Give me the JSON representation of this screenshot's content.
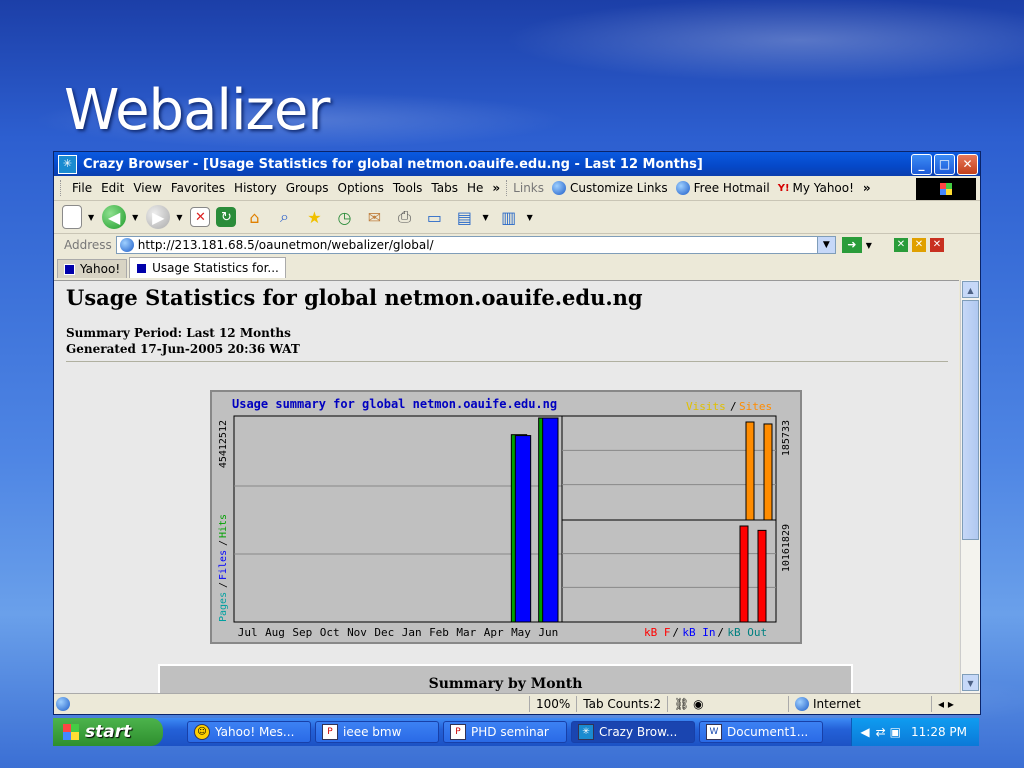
{
  "slide": {
    "title": "Webalizer"
  },
  "window": {
    "title": "Crazy Browser - [Usage Statistics for global netmon.oauife.edu.ng - Last 12 Months]",
    "controls": {
      "minimize": "_",
      "maximize": "□",
      "close": "✕"
    }
  },
  "menu": {
    "items": [
      "File",
      "Edit",
      "View",
      "Favorites",
      "History",
      "Groups",
      "Options",
      "Tools",
      "Tabs",
      "He"
    ],
    "more": "»",
    "links_label": "Links",
    "links": [
      "Customize Links",
      "Free Hotmail",
      "My Yahoo!"
    ],
    "links_more": "»"
  },
  "address": {
    "label": "Address",
    "url": "http://213.181.68.5/oaunetmon/webalizer/global/"
  },
  "tabs": [
    {
      "label": "Yahoo!",
      "active": false
    },
    {
      "label": "Usage Statistics for...",
      "active": true
    }
  ],
  "page": {
    "heading": "Usage Statistics for global netmon.oauife.edu.ng",
    "summary_period": "Summary Period: Last 12 Months",
    "generated": "Generated 17-Jun-2005 20:36 WAT",
    "month_summary_title": "Summary by Month"
  },
  "chart_data": {
    "type": "bar",
    "title": "Usage summary for global netmon.oauife.edu.ng",
    "categories": [
      "Jul",
      "Aug",
      "Sep",
      "Oct",
      "Nov",
      "Dec",
      "Jan",
      "Feb",
      "Mar",
      "Apr",
      "May",
      "Jun"
    ],
    "left_panel": {
      "ymax_label": "45412512",
      "ymax": 45412512,
      "legend": [
        "Pages",
        "Files",
        "Hits"
      ],
      "series": [
        {
          "name": "Hits",
          "color": "#00a000",
          "values": [
            0,
            0,
            0,
            0,
            0,
            0,
            0,
            0,
            0,
            0,
            41700000,
            45412512
          ]
        },
        {
          "name": "Files",
          "color": "#0000ff",
          "values": [
            0,
            0,
            0,
            0,
            0,
            0,
            0,
            0,
            0,
            0,
            41500000,
            45412512
          ]
        }
      ]
    },
    "right_top_panel": {
      "ymax_label": "185733",
      "ymax": 185733,
      "legend": [
        "Visits",
        "Sites"
      ],
      "series": [
        {
          "name": "Visits",
          "color": "#ff8c00",
          "values": [
            185733,
            182000
          ]
        }
      ]
    },
    "right_bottom_panel": {
      "ymax_label": "10161829",
      "ymax": 10161829,
      "legend": [
        "kB F",
        "kB In",
        "kB Out"
      ],
      "series": [
        {
          "name": "kB F",
          "color": "#ff0000",
          "values": [
            10161829,
            9700000
          ]
        }
      ]
    },
    "colors": {
      "visits": "#e0c000",
      "sites": "#ff8c00",
      "pages": "#00a0a0",
      "files": "#0000ff",
      "hits": "#00a000",
      "kbf": "#ff0000",
      "kbin": "#0000ff",
      "kbout": "#008080",
      "title": "#0000c0"
    }
  },
  "status": {
    "zoom": "100%",
    "tab_counts": "Tab Counts:2",
    "zone": "Internet",
    "nav": "◂ ▸"
  },
  "taskbar": {
    "start": "start",
    "tasks": [
      {
        "label": "Yahoo! Mes...",
        "icon": "yahoo-messenger-icon",
        "active": false
      },
      {
        "label": "ieee bmw",
        "icon": "powerpoint-icon",
        "active": false
      },
      {
        "label": "PHD seminar",
        "icon": "powerpoint-icon",
        "active": false
      },
      {
        "label": "Crazy Brow...",
        "icon": "crazy-browser-icon",
        "active": true
      },
      {
        "label": "Document1...",
        "icon": "word-icon",
        "active": false
      }
    ],
    "clock": "11:28 PM"
  }
}
